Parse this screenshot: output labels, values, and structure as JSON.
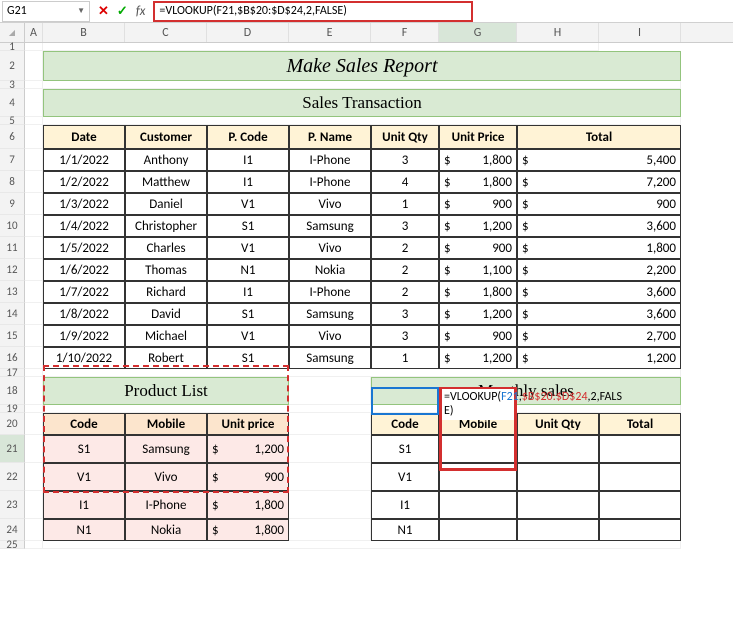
{
  "name_box": "G21",
  "formula_bar": "=VLOOKUP(F21,$B$20:$D$24,2,FALSE)",
  "columns": [
    "A",
    "B",
    "C",
    "D",
    "E",
    "F",
    "G",
    "H",
    "I"
  ],
  "row_heights": {
    "1": 8,
    "2": 30,
    "3": 8,
    "4": 28,
    "5": 8,
    "6": 24,
    "7": 22,
    "8": 22,
    "9": 22,
    "10": 22,
    "11": 22,
    "12": 22,
    "13": 22,
    "14": 22,
    "15": 22,
    "16": 22,
    "17": 8,
    "18": 28,
    "19": 8,
    "20": 22,
    "21": 28,
    "22": 28,
    "23": 28,
    "24": 22,
    "25": 8
  },
  "titles": {
    "main": "Make Sales Report",
    "sub": "Sales Transaction",
    "product_list": "Product List",
    "monthly_sales": "Monthly sales"
  },
  "sales_headers": [
    "Date",
    "Customer",
    "P. Code",
    "P. Name",
    "Unit Qty",
    "Unit Price",
    "Total"
  ],
  "sales_rows": [
    {
      "date": "1/1/2022",
      "cust": "Anthony",
      "code": "I1",
      "name": "I-Phone",
      "qty": "3",
      "price": "1,800",
      "total": "5,400"
    },
    {
      "date": "1/2/2022",
      "cust": "Matthew",
      "code": "I1",
      "name": "I-Phone",
      "qty": "4",
      "price": "1,800",
      "total": "7,200"
    },
    {
      "date": "1/3/2022",
      "cust": "Daniel",
      "code": "V1",
      "name": "Vivo",
      "qty": "1",
      "price": "900",
      "total": "900"
    },
    {
      "date": "1/4/2022",
      "cust": "Christopher",
      "code": "S1",
      "name": "Samsung",
      "qty": "3",
      "price": "1,200",
      "total": "3,600"
    },
    {
      "date": "1/5/2022",
      "cust": "Charles",
      "code": "V1",
      "name": "Vivo",
      "qty": "2",
      "price": "900",
      "total": "1,800"
    },
    {
      "date": "1/6/2022",
      "cust": "Thomas",
      "code": "N1",
      "name": "Nokia",
      "qty": "2",
      "price": "1,100",
      "total": "2,200"
    },
    {
      "date": "1/7/2022",
      "cust": "Richard",
      "code": "I1",
      "name": "I-Phone",
      "qty": "2",
      "price": "1,800",
      "total": "3,600"
    },
    {
      "date": "1/8/2022",
      "cust": "David",
      "code": "S1",
      "name": "Samsung",
      "qty": "3",
      "price": "1,200",
      "total": "3,600"
    },
    {
      "date": "1/9/2022",
      "cust": "Michael",
      "code": "V1",
      "name": "Vivo",
      "qty": "3",
      "price": "900",
      "total": "2,700"
    },
    {
      "date": "1/10/2022",
      "cust": "Robert",
      "code": "S1",
      "name": "Samsung",
      "qty": "1",
      "price": "1,200",
      "total": "1,200"
    }
  ],
  "product_headers": [
    "Code",
    "Mobile",
    "Unit price"
  ],
  "product_rows": [
    {
      "code": "S1",
      "mobile": "Samsung",
      "price": "1,200"
    },
    {
      "code": "V1",
      "mobile": "Vivo",
      "price": "900"
    },
    {
      "code": "I1",
      "mobile": "I-Phone",
      "price": "1,800"
    },
    {
      "code": "N1",
      "mobile": "Nokia",
      "price": "1,800"
    }
  ],
  "monthly_headers": [
    "Code",
    "Mobile",
    "Unit Qty",
    "Total"
  ],
  "monthly_rows": [
    {
      "code": "S1"
    },
    {
      "code": "V1"
    },
    {
      "code": "I1"
    },
    {
      "code": "N1"
    }
  ],
  "formula_overlay": {
    "p1": "=VLOOKUP(",
    "p2": "F21",
    "p3": ",",
    "p4": "$B$20:$D$24",
    "p5": ",",
    "p6": "2",
    "p7": ",FALS",
    "p8": "E",
    "p9": ")"
  },
  "dollar": "$"
}
